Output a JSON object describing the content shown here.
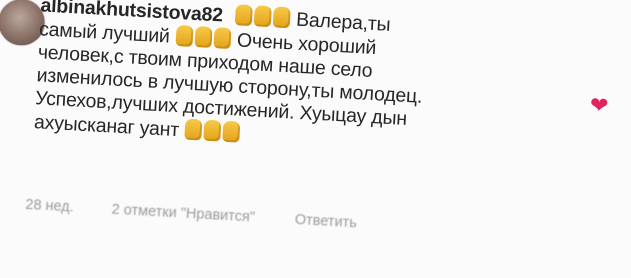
{
  "comment": {
    "username": "albinakhutsistova82",
    "lines": [
      "Валера,ты",
      "самый лучший",
      "Очень хороший",
      "человек,с твоим приходом наше село",
      "изменилось в лучшую сторону,ты молодец.",
      "Успехов,лучших достижений. Хуыцау дын",
      "ахуысканаг уант"
    ],
    "emoji_icon": "clapping-hands-emoji-icon",
    "time": "28 нед.",
    "likes": "2 отметки \"Нравится\"",
    "reply_label": "Ответить",
    "heart_icon": "heart-icon",
    "heart_color": "#e0245e"
  }
}
